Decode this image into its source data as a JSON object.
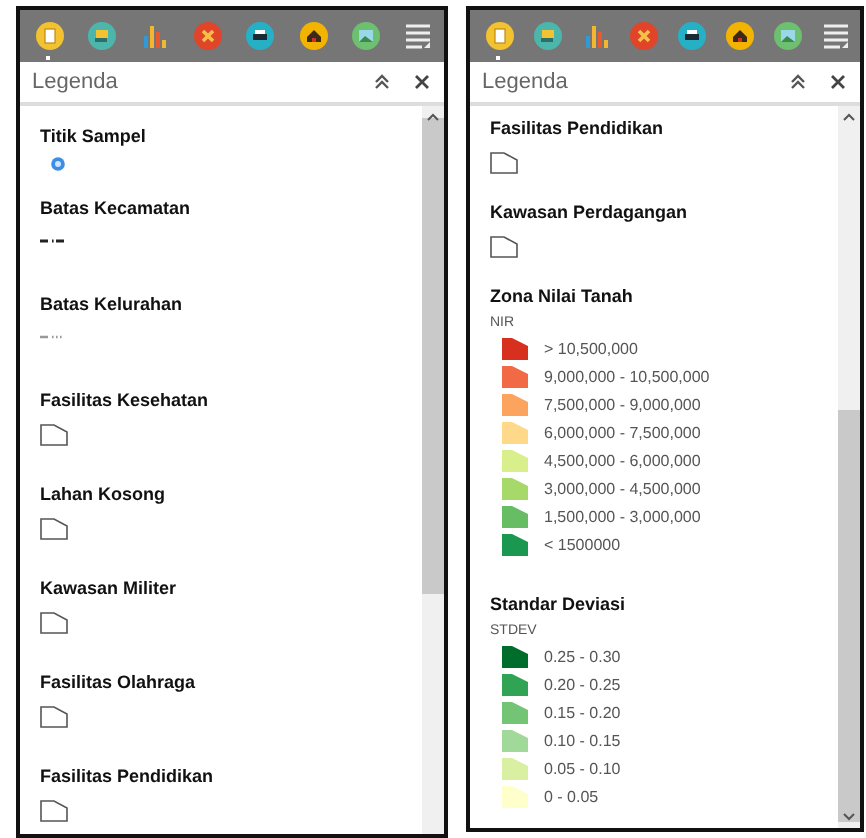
{
  "panels": [
    {
      "tools": [
        {
          "kind": "page",
          "selected": true
        },
        {
          "kind": "layers",
          "selected": false
        },
        {
          "kind": "chart",
          "selected": false
        },
        {
          "kind": "cross",
          "selected": false
        },
        {
          "kind": "printer",
          "selected": false
        },
        {
          "kind": "home",
          "selected": false
        },
        {
          "kind": "image",
          "selected": false
        },
        {
          "kind": "menu",
          "selected": false
        }
      ],
      "title": "Legenda",
      "sections": [
        {
          "kind": "point",
          "title": "Titik Sampel"
        },
        {
          "kind": "dashdot_line",
          "title": "Batas Kecamatan"
        },
        {
          "kind": "dotted_line",
          "title": "Batas Kelurahan"
        },
        {
          "kind": "polygon",
          "title": "Fasilitas Kesehatan"
        },
        {
          "kind": "polygon",
          "title": "Lahan Kosong"
        },
        {
          "kind": "polygon",
          "title": "Kawasan Militer"
        },
        {
          "kind": "polygon",
          "title": "Fasilitas Olahraga"
        },
        {
          "kind": "polygon",
          "title": "Fasilitas Pendidikan"
        }
      ]
    },
    {
      "tools": [
        {
          "kind": "page",
          "selected": true
        },
        {
          "kind": "layers",
          "selected": false
        },
        {
          "kind": "chart",
          "selected": false
        },
        {
          "kind": "cross",
          "selected": false
        },
        {
          "kind": "printer",
          "selected": false
        },
        {
          "kind": "home",
          "selected": false
        },
        {
          "kind": "image",
          "selected": false
        },
        {
          "kind": "menu",
          "selected": false
        }
      ],
      "title": "Legenda",
      "sections": [
        {
          "kind": "polygon",
          "title": "Fasilitas Pendidikan"
        },
        {
          "kind": "polygon",
          "title": "Kawasan Perdagangan"
        },
        {
          "kind": "classes",
          "title": "Zona Nilai Tanah",
          "field": "NIR",
          "items": [
            {
              "label": "> 10,500,000",
              "color": "#d7301f"
            },
            {
              "label": "9,000,000 - 10,500,000",
              "color": "#f16a45"
            },
            {
              "label": "7,500,000 - 9,000,000",
              "color": "#fca35d"
            },
            {
              "label": "6,000,000 - 7,500,000",
              "color": "#fed98a"
            },
            {
              "label": "4,500,000 - 6,000,000",
              "color": "#d9ef8b"
            },
            {
              "label": "3,000,000 - 4,500,000",
              "color": "#a6d96a"
            },
            {
              "label": "1,500,000 - 3,000,000",
              "color": "#66bd63"
            },
            {
              "label": "< 1500000",
              "color": "#1a9850"
            }
          ]
        },
        {
          "kind": "classes",
          "title": "Standar Deviasi",
          "field": "STDEV",
          "items": [
            {
              "label": "0.25 - 0.30",
              "color": "#006d2c"
            },
            {
              "label": "0.20 - 0.25",
              "color": "#31a354"
            },
            {
              "label": "0.15 - 0.20",
              "color": "#74c476"
            },
            {
              "label": "0.10 - 0.15",
              "color": "#a1d99b"
            },
            {
              "label": "0.05 - 0.10",
              "color": "#d9f0a3"
            },
            {
              "label": "0 - 0.05",
              "color": "#ffffcc"
            }
          ]
        }
      ]
    }
  ]
}
